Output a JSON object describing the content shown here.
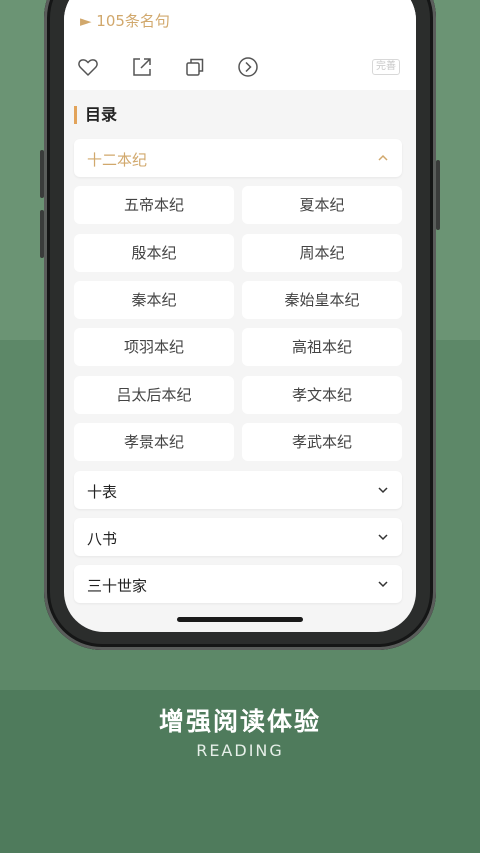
{
  "header": {
    "quote_count": "► 105条名句"
  },
  "toolbar": {
    "icons": [
      "heart-icon",
      "share-icon",
      "copy-icon",
      "next-circle-icon"
    ],
    "improve_label": "完善"
  },
  "catalog": {
    "title": "目录",
    "groups": [
      {
        "label": "十二本纪",
        "expanded": true,
        "items": [
          "五帝本纪",
          "夏本纪",
          "殷本纪",
          "周本纪",
          "秦本纪",
          "秦始皇本纪",
          "项羽本纪",
          "高祖本纪",
          "吕太后本纪",
          "孝文本纪",
          "孝景本纪",
          "孝武本纪"
        ]
      },
      {
        "label": "十表",
        "expanded": false
      },
      {
        "label": "八书",
        "expanded": false
      },
      {
        "label": "三十世家",
        "expanded": false
      }
    ]
  },
  "caption": {
    "main": "增强阅读体验",
    "sub": "READING"
  },
  "colors": {
    "accent": "#d1a86c",
    "background": "#5f8a6c"
  }
}
